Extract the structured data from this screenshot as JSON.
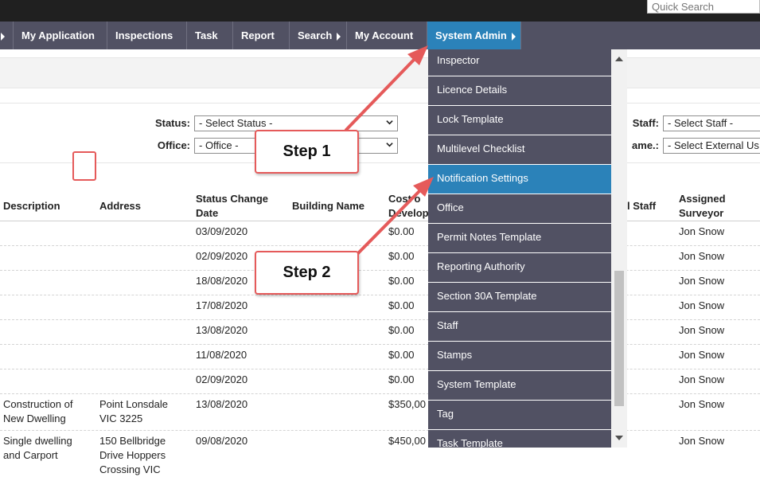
{
  "search": {
    "placeholder": "Quick Search"
  },
  "nav": {
    "items": [
      {
        "label": "My Application"
      },
      {
        "label": "Inspections"
      },
      {
        "label": "Task"
      },
      {
        "label": "Report"
      },
      {
        "label": "Search"
      },
      {
        "label": "My Account"
      },
      {
        "label": "System Admin"
      }
    ]
  },
  "filters": {
    "status_label": "Status:",
    "status_value": "- Select Status -",
    "office_label": "Office:",
    "office_value": "- Office -",
    "staff_label": "Staff:",
    "staff_value": "- Select Staff -",
    "external_label": "ame.:",
    "external_value": "- Select External Us"
  },
  "table": {
    "headers": {
      "description": "Description",
      "address": "Address",
      "status_change_date": "Status Change Date",
      "building_name": "Building Name",
      "cost": "Cost o Develop",
      "staff": "l Staff",
      "assigned_surveyor": "Assigned Surveyor"
    },
    "rows": [
      {
        "description": "",
        "address": "",
        "date": "03/09/2020",
        "cost": "$0.00",
        "surveyor": "Jon Snow"
      },
      {
        "description": "",
        "address": "",
        "date": "02/09/2020",
        "cost": "$0.00",
        "surveyor": "Jon Snow"
      },
      {
        "description": "",
        "address": "",
        "date": "18/08/2020",
        "cost": "$0.00",
        "surveyor": "Jon Snow"
      },
      {
        "description": "",
        "address": "",
        "date": "17/08/2020",
        "cost": "$0.00",
        "surveyor": "Jon Snow"
      },
      {
        "description": "",
        "address": "",
        "date": "13/08/2020",
        "cost": "$0.00",
        "surveyor": "Jon Snow"
      },
      {
        "description": "",
        "address": "",
        "date": "11/08/2020",
        "cost": "$0.00",
        "surveyor": "Jon Snow"
      },
      {
        "description": "",
        "address": "",
        "date": "02/09/2020",
        "cost": "$0.00",
        "surveyor": "Jon Snow"
      },
      {
        "description": "Construction of New Dwelling",
        "address": "Point Lonsdale VIC 3225",
        "date": "13/08/2020",
        "cost": "$350,00",
        "surveyor": "Jon Snow"
      },
      {
        "description": "Single dwelling and Carport",
        "address": "150 Bellbridge Drive Hoppers Crossing VIC",
        "date": "09/08/2020",
        "cost": "$450,00",
        "surveyor": "Jon Snow"
      }
    ]
  },
  "dropdown": {
    "items": [
      {
        "label": "Inspector"
      },
      {
        "label": "Licence Details"
      },
      {
        "label": "Lock Template"
      },
      {
        "label": "Multilevel Checklist"
      },
      {
        "label": "Notification Settings"
      },
      {
        "label": "Office"
      },
      {
        "label": "Permit Notes Template"
      },
      {
        "label": "Reporting Authority"
      },
      {
        "label": "Section 30A Template"
      },
      {
        "label": "Staff"
      },
      {
        "label": "Stamps"
      },
      {
        "label": "System Template"
      },
      {
        "label": "Tag"
      },
      {
        "label": "Task Template"
      }
    ]
  },
  "annotations": {
    "step1": "Step 1",
    "step2": "Step 2"
  },
  "colors": {
    "nav_bg": "#515163",
    "active_blue": "#2b82b9",
    "annotation_red": "#e55a5a",
    "top_strip": "#202020"
  }
}
